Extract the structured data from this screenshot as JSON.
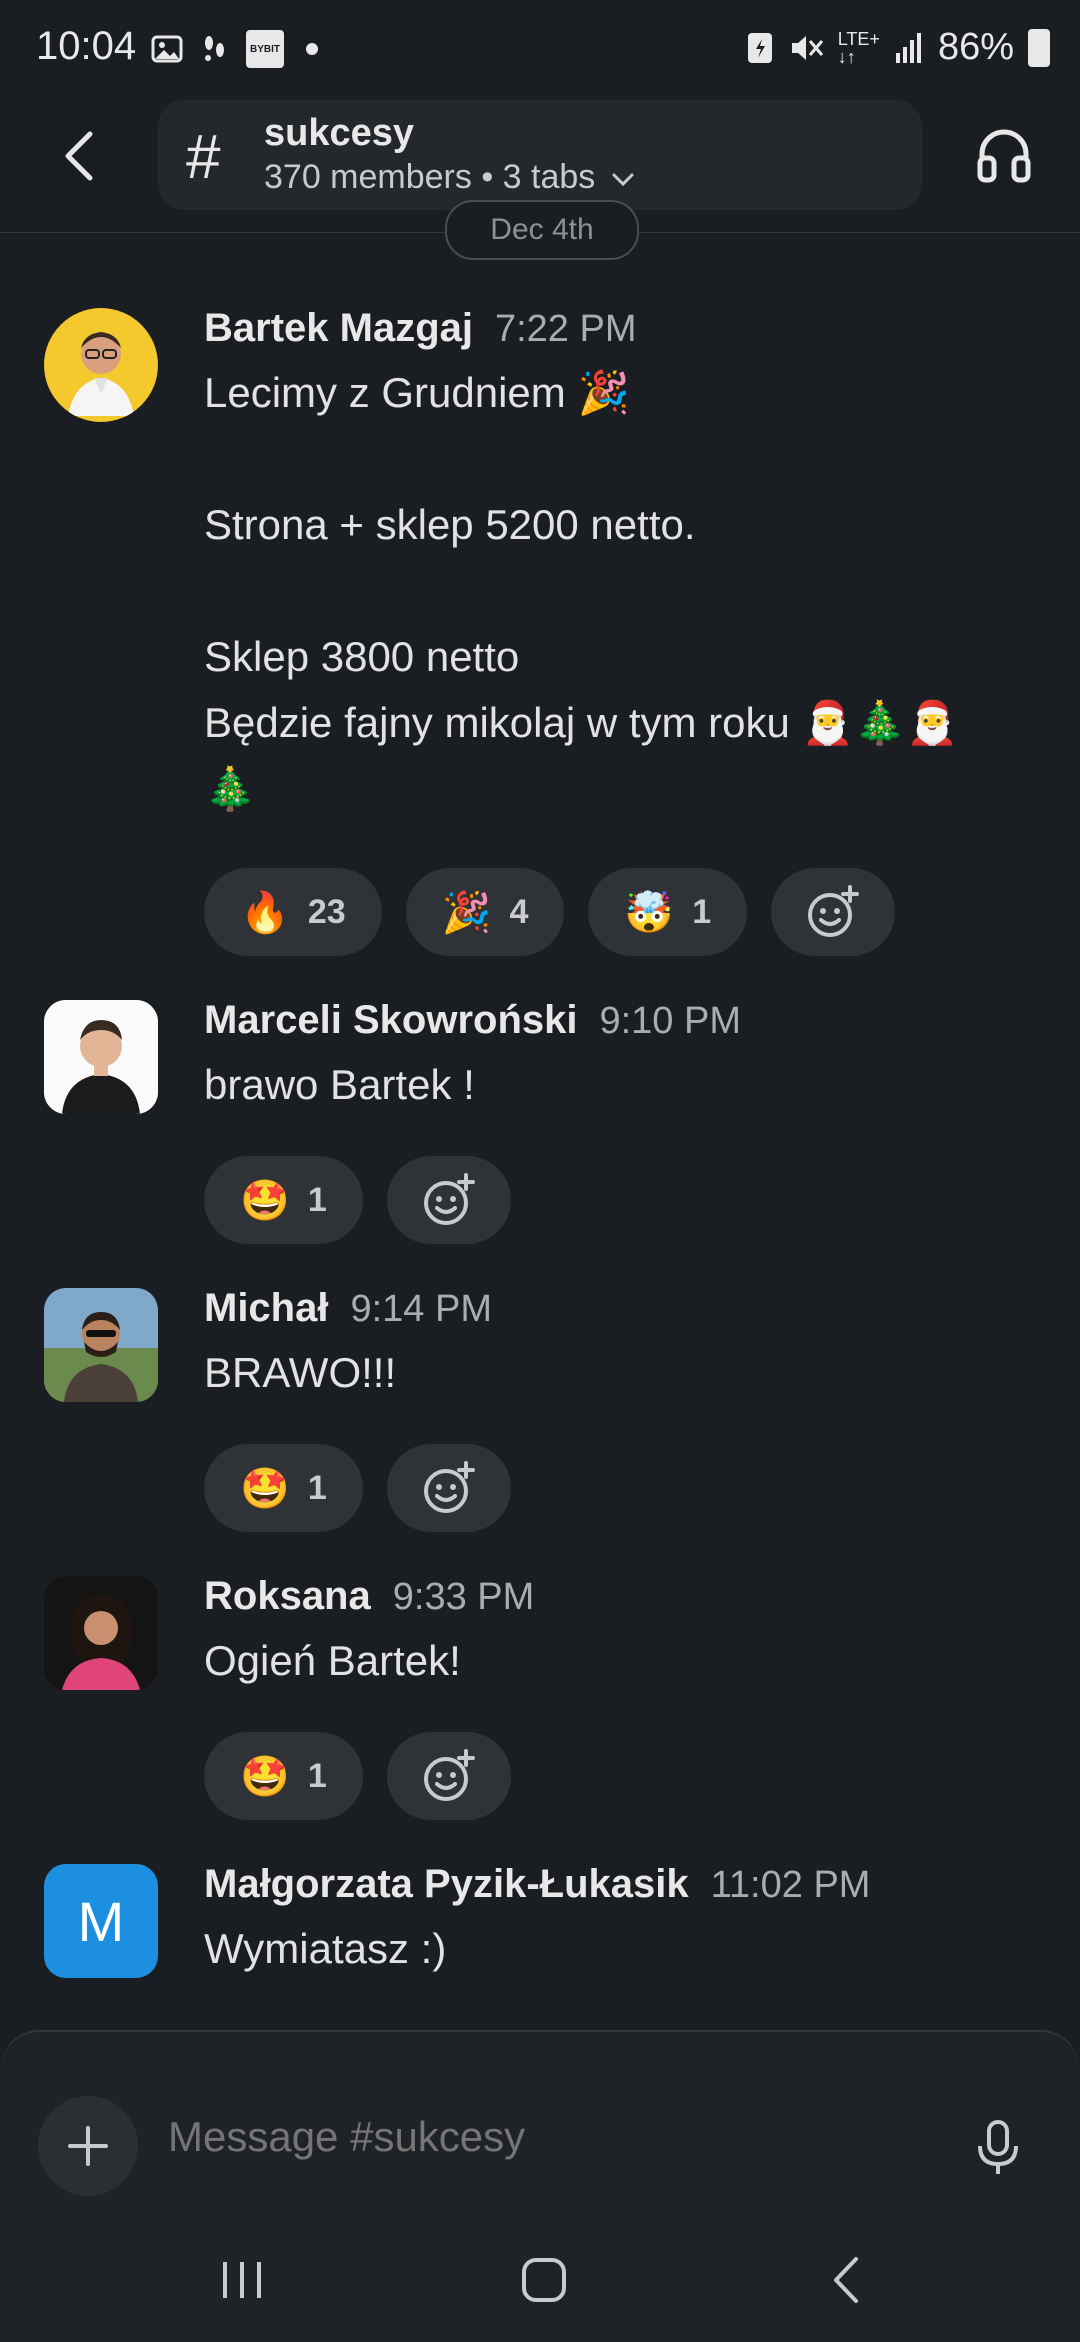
{
  "status_bar": {
    "time": "10:04",
    "battery": "86%",
    "network": "LTE+",
    "bybit_label": "BYBIT"
  },
  "header": {
    "channel_name": "sukcesy",
    "channel_sub": "370 members • 3 tabs",
    "hash_symbol": "#"
  },
  "date_divider": "Dec 4th",
  "messages": [
    {
      "author": "Bartek Mazgaj",
      "time": "7:22 PM",
      "text": "Lecimy z Grudniem 🎉\n\nStrona + sklep 5200 netto.\n\nSklep 3800 netto\nBędzie fajny mikolaj w tym roku 🎅🎄🎅\n🎄",
      "reactions": [
        {
          "emoji": "🔥",
          "count": "23"
        },
        {
          "emoji": "🎉",
          "count": "4"
        },
        {
          "emoji": "🤯",
          "count": "1"
        }
      ]
    },
    {
      "author": "Marceli Skowroński",
      "time": "9:10 PM",
      "text": "brawo Bartek !",
      "reactions": [
        {
          "emoji": "🤩",
          "count": "1"
        }
      ]
    },
    {
      "author": "Michał",
      "time": "9:14 PM",
      "text": "BRAWO!!!",
      "reactions": [
        {
          "emoji": "🤩",
          "count": "1"
        }
      ]
    },
    {
      "author": "Roksana",
      "time": "9:33 PM",
      "text": "Ogień Bartek!",
      "reactions": [
        {
          "emoji": "🤩",
          "count": "1"
        }
      ]
    },
    {
      "author": "Małgorzata Pyzik-Łukasik",
      "time": "11:02 PM",
      "text": "Wymiatasz :)",
      "avatar_letter": "M"
    }
  ],
  "composer": {
    "placeholder": "Message #sukcesy"
  },
  "colors": {
    "background": "#1a1d21",
    "pill": "#2f3237",
    "avatar_m": "#1d8fe0"
  }
}
